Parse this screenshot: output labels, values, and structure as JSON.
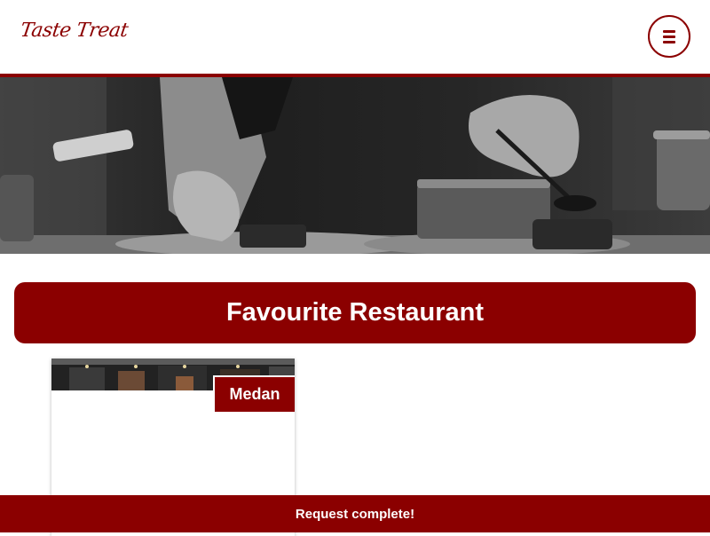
{
  "header": {
    "logo_text": "Taste Treat",
    "menu_button_icon": "hamburger-icon"
  },
  "hero": {
    "image": "chefs-plating-food-monochrome"
  },
  "favourites": {
    "title": "Favourite Restaurant",
    "cards": [
      {
        "city": "Medan",
        "image": "restaurant-interior"
      }
    ]
  },
  "toast": {
    "message": "Request complete!"
  },
  "colors": {
    "brand": "#8b0000",
    "background": "#ffffff",
    "text_on_brand": "#ffffff"
  }
}
